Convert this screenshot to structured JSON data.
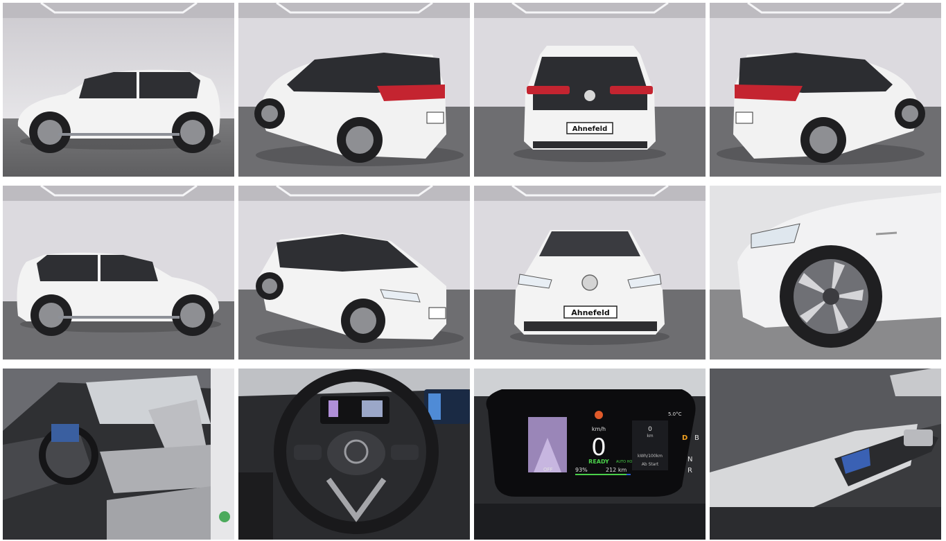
{
  "gallery": {
    "plate_text": "Ahnefeld",
    "photos": [
      {
        "name": "side-left"
      },
      {
        "name": "rear-three-quarter-left"
      },
      {
        "name": "rear"
      },
      {
        "name": "rear-three-quarter-right"
      },
      {
        "name": "side-right"
      },
      {
        "name": "front-three-quarter-left"
      },
      {
        "name": "front"
      },
      {
        "name": "wheel-detail"
      },
      {
        "name": "interior-seats"
      },
      {
        "name": "steering-wheel"
      },
      {
        "name": "instrument-display"
      },
      {
        "name": "door-panel"
      }
    ]
  },
  "display": {
    "temperature": "5.0°C",
    "speed_unit": "km/h",
    "speed": "0",
    "ready_label": "READY",
    "auto_hold": "AUTO HOLD",
    "battery": "93%",
    "range": "212 km",
    "off_label": "OFF",
    "km_value": "0",
    "km_unit": "km",
    "consumption_unit": "kWh/100km",
    "since_start": "Ab Start",
    "gear_d": "D",
    "gear_b": "B",
    "gear_n": "N",
    "gear_r": "R"
  },
  "colors": {
    "studio_wall": "#d9d7db",
    "studio_floor": "#6f6f72",
    "car_white": "#f3f3f3",
    "roof_black": "#2b2b2e",
    "tail_red": "#c0202a",
    "ready_green": "#4ad04a"
  }
}
